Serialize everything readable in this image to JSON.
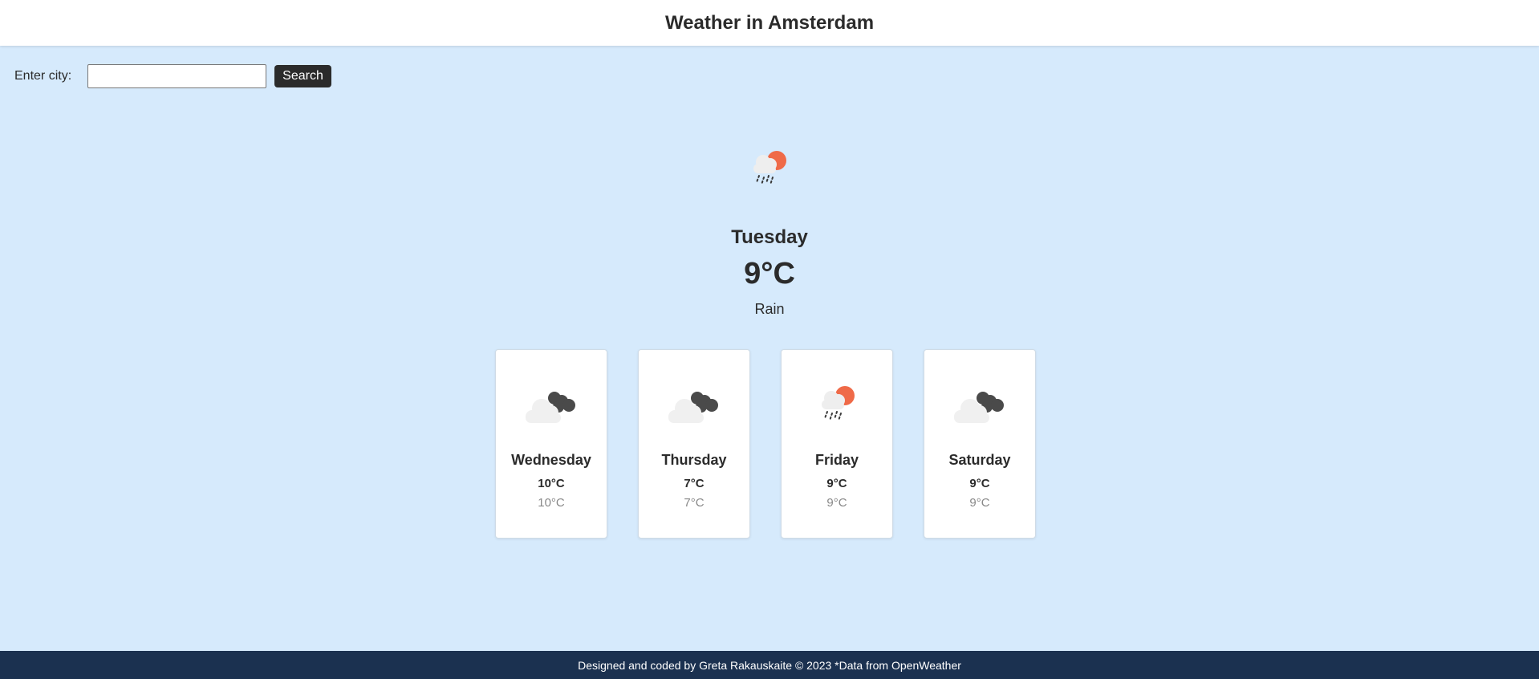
{
  "header": {
    "title": "Weather in Amsterdam"
  },
  "search": {
    "label": "Enter city:",
    "value": "",
    "placeholder": "",
    "button_label": "Search"
  },
  "current": {
    "icon": "rain-sun-icon",
    "day": "Tuesday",
    "temp": "9°C",
    "description": "Rain"
  },
  "forecast": [
    {
      "icon": "cloud-night-icon",
      "day": "Wednesday",
      "high": "10°C",
      "low": "10°C"
    },
    {
      "icon": "cloud-night-icon",
      "day": "Thursday",
      "high": "7°C",
      "low": "7°C"
    },
    {
      "icon": "rain-sun-icon",
      "day": "Friday",
      "high": "9°C",
      "low": "9°C"
    },
    {
      "icon": "cloud-night-icon",
      "day": "Saturday",
      "high": "9°C",
      "low": "9°C"
    }
  ],
  "footer": {
    "text": "Designed and coded by Greta Rakauskaite © 2023 *Data from OpenWeather"
  },
  "colors": {
    "background": "#d6eafc",
    "sun": "#ef6a48",
    "cloud_dark": "#4a4a4a",
    "cloud_light": "#f0f0f0",
    "footer": "#1b3150"
  }
}
